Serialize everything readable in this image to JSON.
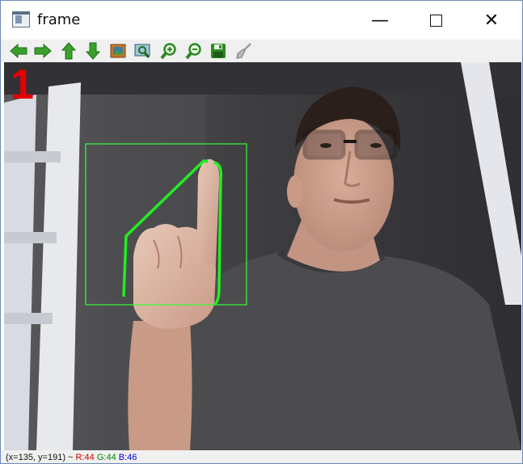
{
  "window": {
    "title": "frame"
  },
  "window_controls": {
    "minimize": "—",
    "close": "✕"
  },
  "toolbar": {
    "buttons": [
      {
        "icon": "arrow-left-icon"
      },
      {
        "icon": "arrow-right-icon"
      },
      {
        "icon": "arrow-up-icon"
      },
      {
        "icon": "arrow-down-icon"
      },
      {
        "icon": "image-icon"
      },
      {
        "icon": "zoom-region-icon"
      },
      {
        "icon": "zoom-in-icon"
      },
      {
        "icon": "zoom-out-icon"
      },
      {
        "icon": "save-icon"
      },
      {
        "icon": "brush-icon"
      }
    ]
  },
  "overlay": {
    "digit": "1"
  },
  "status": {
    "coords": "(x=135, y=191) ~ ",
    "r": "R:44",
    "g": "G:44",
    "b": "B:46"
  },
  "colors": {
    "bounding_box": "#33ff33",
    "contour": "#22ee22",
    "digit": "#e60000"
  }
}
